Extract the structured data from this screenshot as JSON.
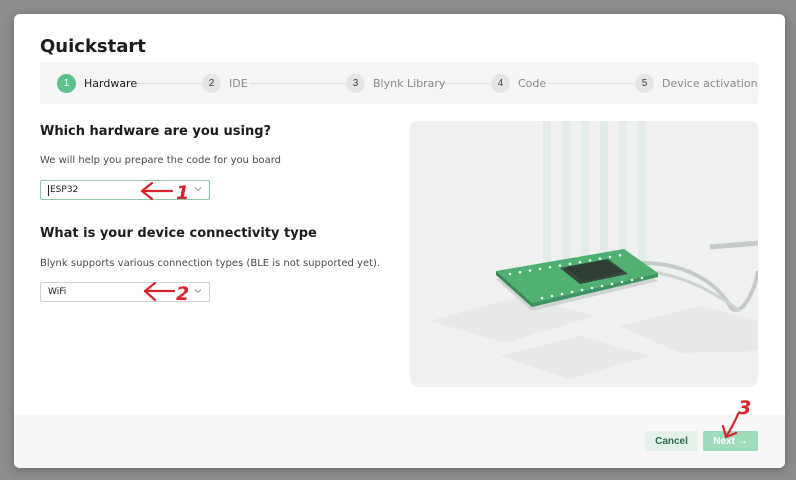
{
  "modal": {
    "title": "Quickstart"
  },
  "stepper": {
    "steps": [
      {
        "number": "1",
        "label": "Hardware",
        "active": true
      },
      {
        "number": "2",
        "label": "IDE",
        "active": false
      },
      {
        "number": "3",
        "label": "Blynk Library",
        "active": false
      },
      {
        "number": "4",
        "label": "Code",
        "active": false
      },
      {
        "number": "5",
        "label": "Device activation",
        "active": false
      }
    ]
  },
  "hardware": {
    "title": "Which hardware are you using?",
    "help": "We will help you prepare the code for you board",
    "selected": "ESP32"
  },
  "connectivity": {
    "title": "What is your device connectivity type",
    "help": "Blynk supports various connection types (BLE is not supported yet).",
    "selected": "WiFi"
  },
  "footer": {
    "cancel_label": "Cancel",
    "next_label": "Next",
    "next_arrow": "→"
  },
  "annotations": {
    "first": "1",
    "second": "2",
    "third": "3",
    "color": "#d9232e"
  },
  "colors": {
    "accent": "#5cc28b",
    "next_button": "#9fdcbc",
    "cancel_button": "#e4f1e9"
  },
  "icons": {
    "select_arrow": "chevron-down-icon",
    "next_arrow": "arrow-right-icon"
  }
}
